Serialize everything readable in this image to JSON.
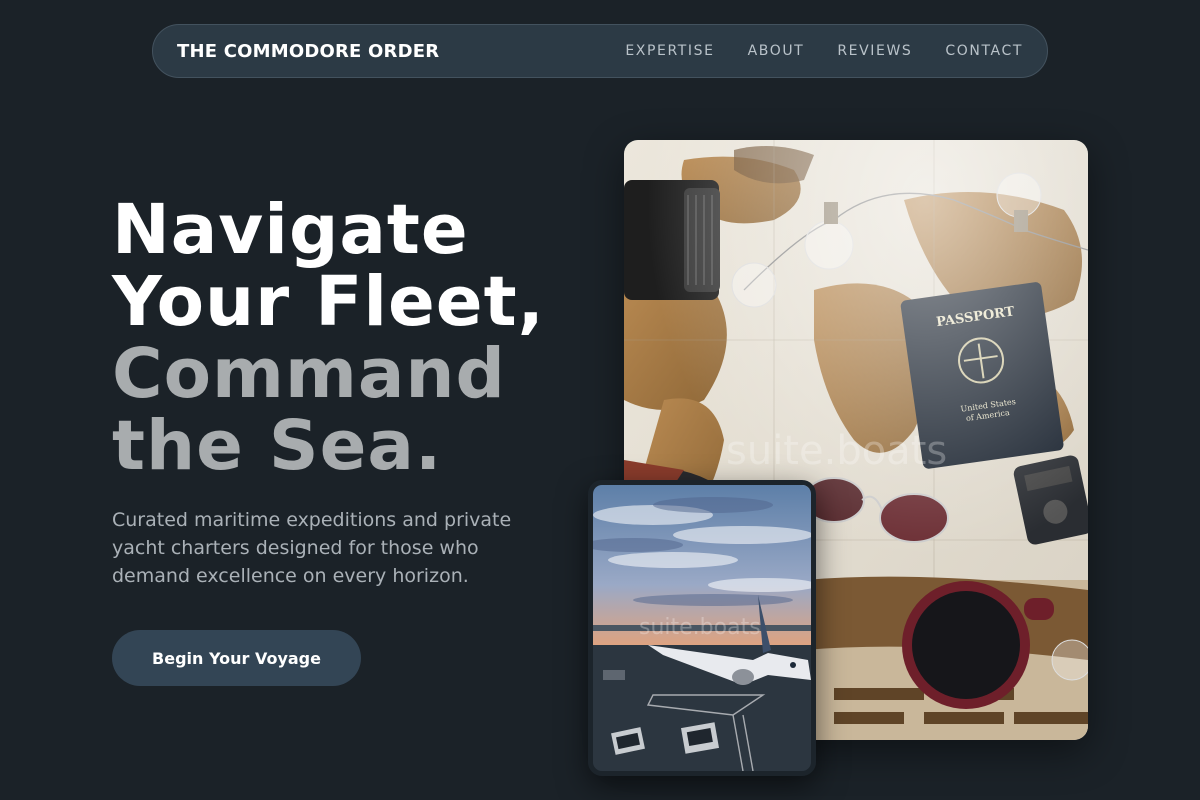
{
  "nav": {
    "brand": "THE COMMODORE ORDER",
    "links": [
      "EXPERTISE",
      "ABOUT",
      "REVIEWS",
      "CONTACT"
    ]
  },
  "hero": {
    "headline_lines_white": [
      "Navigate",
      "Your Fleet,"
    ],
    "headline_lines_grey": [
      "Command",
      "the Sea."
    ],
    "lede": "Curated maritime expeditions and private yacht charters designed for those who demand excellence on every horizon.",
    "cta_label": "Begin Your Voyage"
  },
  "images": {
    "main_alt": "Flat lay of a world map with passport, camera lens, sunglasses, string lights and a cup of coffee",
    "main_watermark": "suite.boats",
    "small_alt": "Airplane on an airport tarmac at sunset",
    "small_watermark": "suite.boats"
  },
  "colors": {
    "background": "#1b2228",
    "nav_bg": "#2c3a45",
    "cta_bg": "#334555",
    "headline_grey": "#a8acae"
  }
}
